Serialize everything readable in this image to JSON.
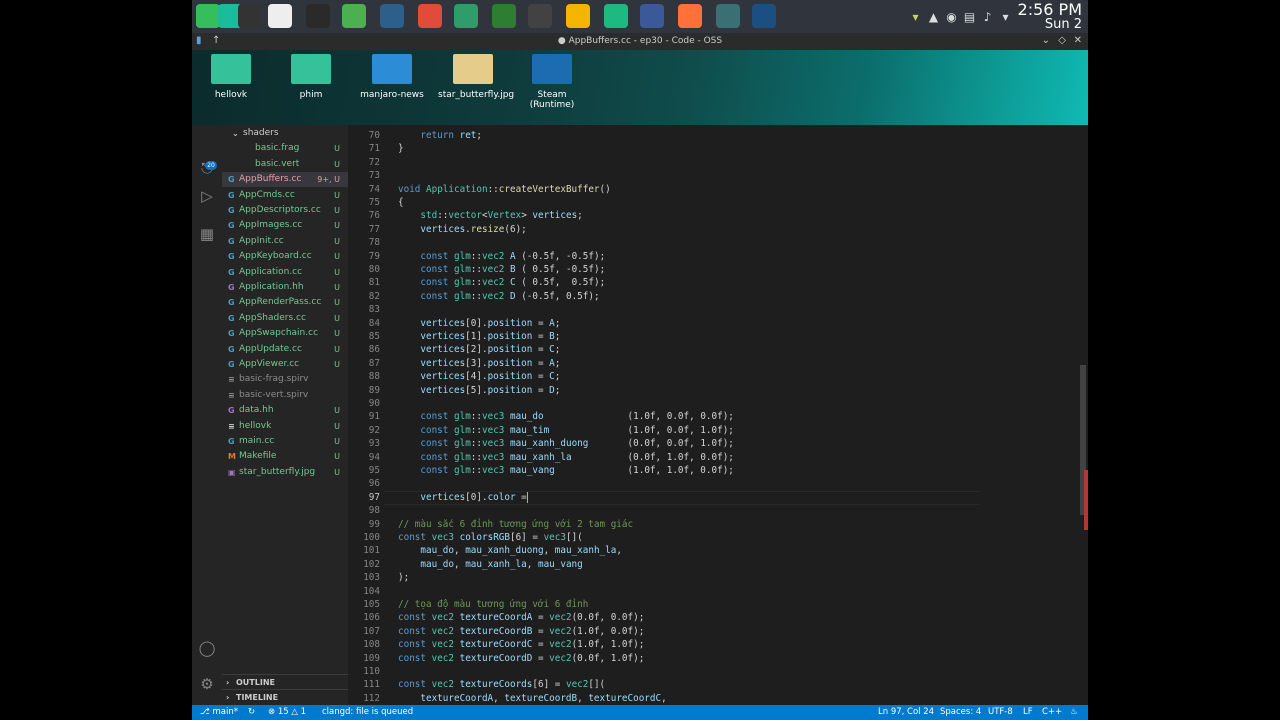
{
  "taskbar": {
    "clock_time": "2:56 PM",
    "clock_date": "Sun 2",
    "app_icons": [
      {
        "name": "manjaro-icon",
        "color": "#35bf5c"
      },
      {
        "name": "show-desktop-icon",
        "color": "#1abc9c"
      },
      {
        "name": "terminal-icon",
        "color": "#333333"
      },
      {
        "name": "settings-grid-icon",
        "color": "#eeeeee"
      },
      {
        "name": "obs-icon",
        "color": "#2a2a2a"
      },
      {
        "name": "files-icon",
        "color": "#4caf50"
      },
      {
        "name": "vscode-icon",
        "color": "#2d5f8b"
      },
      {
        "name": "chrome-icon",
        "color": "#e24a3a"
      },
      {
        "name": "green-app-icon",
        "color": "#2e9d6a"
      },
      {
        "name": "spreadsheet-icon",
        "color": "#2e7d32"
      },
      {
        "name": "terminal-2-icon",
        "color": "#424242"
      },
      {
        "name": "color-app-icon",
        "color": "#f4b400"
      },
      {
        "name": "whatsapp-icon",
        "color": "#1db980"
      },
      {
        "name": "triangle-app-icon",
        "color": "#3b5998"
      },
      {
        "name": "firefox-icon",
        "color": "#ff7139"
      },
      {
        "name": "gear-app-icon",
        "color": "#3a6f73"
      },
      {
        "name": "steam-icon",
        "color": "#1b4f82"
      }
    ]
  },
  "window": {
    "title": "● AppBuffers.cc - ep30 - Code - OSS"
  },
  "desktop": {
    "icons": [
      {
        "label": "hellovk",
        "color": "#35c29a"
      },
      {
        "label": "phim",
        "color": "#35c29a"
      },
      {
        "label": "manjaro-news",
        "color": "#2c8cd6"
      },
      {
        "label": "star_butterfly.jpg",
        "color": "#e6cc8a"
      },
      {
        "label": "Steam (Runtime)",
        "color": "#1b6cb0"
      }
    ]
  },
  "sidebar": {
    "files": [
      {
        "name": "shaders",
        "icon": "⌄",
        "icon_color": "#cccccc",
        "status": "",
        "color": "#cccccc",
        "indent": 10
      },
      {
        "name": "basic.frag",
        "icon": "",
        "icon_color": "#cccccc",
        "status": "U",
        "color": "#73c991",
        "indent": 22
      },
      {
        "name": "basic.vert",
        "icon": "",
        "icon_color": "#cccccc",
        "status": "U",
        "color": "#73c991",
        "indent": 22
      },
      {
        "name": "AppBuffers.cc",
        "icon": "G",
        "icon_color": "#519aba",
        "status": "9+, U",
        "color": "#e2a0a0",
        "indent": 6
      },
      {
        "name": "AppCmds.cc",
        "icon": "G",
        "icon_color": "#519aba",
        "status": "U",
        "color": "#73c991",
        "indent": 6
      },
      {
        "name": "AppDescriptors.cc",
        "icon": "G",
        "icon_color": "#519aba",
        "status": "U",
        "color": "#73c991",
        "indent": 6
      },
      {
        "name": "AppImages.cc",
        "icon": "G",
        "icon_color": "#519aba",
        "status": "U",
        "color": "#73c991",
        "indent": 6
      },
      {
        "name": "AppInit.cc",
        "icon": "G",
        "icon_color": "#519aba",
        "status": "U",
        "color": "#73c991",
        "indent": 6
      },
      {
        "name": "AppKeyboard.cc",
        "icon": "G",
        "icon_color": "#519aba",
        "status": "U",
        "color": "#73c991",
        "indent": 6
      },
      {
        "name": "Application.cc",
        "icon": "G",
        "icon_color": "#519aba",
        "status": "U",
        "color": "#73c991",
        "indent": 6
      },
      {
        "name": "Application.hh",
        "icon": "G",
        "icon_color": "#a074c4",
        "status": "U",
        "color": "#73c991",
        "indent": 6
      },
      {
        "name": "AppRenderPass.cc",
        "icon": "G",
        "icon_color": "#519aba",
        "status": "U",
        "color": "#73c991",
        "indent": 6
      },
      {
        "name": "AppShaders.cc",
        "icon": "G",
        "icon_color": "#519aba",
        "status": "U",
        "color": "#73c991",
        "indent": 6
      },
      {
        "name": "AppSwapchain.cc",
        "icon": "G",
        "icon_color": "#519aba",
        "status": "U",
        "color": "#73c991",
        "indent": 6
      },
      {
        "name": "AppUpdate.cc",
        "icon": "G",
        "icon_color": "#519aba",
        "status": "U",
        "color": "#73c991",
        "indent": 6
      },
      {
        "name": "AppViewer.cc",
        "icon": "G",
        "icon_color": "#519aba",
        "status": "U",
        "color": "#73c991",
        "indent": 6
      },
      {
        "name": "basic-frag.spirv",
        "icon": "≡",
        "icon_color": "#8a8a8a",
        "status": "",
        "color": "#8c8c8c",
        "indent": 6
      },
      {
        "name": "basic-vert.spirv",
        "icon": "≡",
        "icon_color": "#8a8a8a",
        "status": "",
        "color": "#8c8c8c",
        "indent": 6
      },
      {
        "name": "data.hh",
        "icon": "G",
        "icon_color": "#a074c4",
        "status": "U",
        "color": "#73c991",
        "indent": 6
      },
      {
        "name": "hellovk",
        "icon": "≡",
        "icon_color": "#cccccc",
        "status": "U",
        "color": "#73c991",
        "indent": 6
      },
      {
        "name": "main.cc",
        "icon": "G",
        "icon_color": "#519aba",
        "status": "U",
        "color": "#73c991",
        "indent": 6
      },
      {
        "name": "Makefile",
        "icon": "M",
        "icon_color": "#e37933",
        "status": "U",
        "color": "#73c991",
        "indent": 6
      },
      {
        "name": "star_butterfly.jpg",
        "icon": "▣",
        "icon_color": "#a074c4",
        "status": "U",
        "color": "#73c991",
        "indent": 6
      }
    ],
    "outline_label": "OUTLINE",
    "timeline_label": "TIMELINE"
  },
  "editor": {
    "lines": [
      {
        "n": "70",
        "code": "    <span class=\"kw\">return</span> <span class=\"vr\">ret</span>;"
      },
      {
        "n": "71",
        "code": "}"
      },
      {
        "n": "72",
        "code": ""
      },
      {
        "n": "73",
        "code": ""
      },
      {
        "n": "74",
        "code": "<span class=\"kw\">void</span> <span class=\"ty\">Application</span>::<span class=\"fn\">createVertexBuffer</span>()"
      },
      {
        "n": "75",
        "code": "{"
      },
      {
        "n": "76",
        "code": "    <span class=\"ty\">std</span>::<span class=\"ty\">vector</span>&lt;<span class=\"ty\">Vertex</span>&gt; <span class=\"vr\">vertices</span>;"
      },
      {
        "n": "77",
        "code": "    <span class=\"vr\">vertices</span>.<span class=\"fn\">resize</span>(6);"
      },
      {
        "n": "78",
        "code": ""
      },
      {
        "n": "79",
        "code": "    <span class=\"kw\">const</span> <span class=\"ty\">glm</span>::<span class=\"ty\">vec2</span> <span class=\"vr\">A</span> (-0.5f, -0.5f);"
      },
      {
        "n": "80",
        "code": "    <span class=\"kw\">const</span> <span class=\"ty\">glm</span>::<span class=\"ty\">vec2</span> <span class=\"vr\">B</span> ( 0.5f, -0.5f);"
      },
      {
        "n": "81",
        "code": "    <span class=\"kw\">const</span> <span class=\"ty\">glm</span>::<span class=\"ty\">vec2</span> <span class=\"vr\">C</span> ( 0.5f,  0.5f);"
      },
      {
        "n": "82",
        "code": "    <span class=\"kw\">const</span> <span class=\"ty\">glm</span>::<span class=\"ty\">vec2</span> <span class=\"vr\">D</span> (-0.5f, 0.5f);"
      },
      {
        "n": "83",
        "code": ""
      },
      {
        "n": "84",
        "code": "    <span class=\"vr\">vertices</span>[0].<span class=\"vr\">position</span> = <span class=\"vr\">A</span>;"
      },
      {
        "n": "85",
        "code": "    <span class=\"vr\">vertices</span>[1].<span class=\"vr\">position</span> = <span class=\"vr\">B</span>;"
      },
      {
        "n": "86",
        "code": "    <span class=\"vr\">vertices</span>[2].<span class=\"vr\">position</span> = <span class=\"vr\">C</span>;"
      },
      {
        "n": "87",
        "code": "    <span class=\"vr\">vertices</span>[3].<span class=\"vr\">position</span> = <span class=\"vr\">A</span>;"
      },
      {
        "n": "88",
        "code": "    <span class=\"vr\">vertices</span>[4].<span class=\"vr\">position</span> = <span class=\"vr\">C</span>;"
      },
      {
        "n": "89",
        "code": "    <span class=\"vr\">vertices</span>[5].<span class=\"vr\">position</span> = <span class=\"vr\">D</span>;"
      },
      {
        "n": "90",
        "code": ""
      },
      {
        "n": "91",
        "code": "    <span class=\"kw\">const</span> <span class=\"ty\">glm</span>::<span class=\"ty\">vec3</span> <span class=\"vr\">mau_do</span>               (1.0f, 0.0f, 0.0f);"
      },
      {
        "n": "92",
        "code": "    <span class=\"kw\">const</span> <span class=\"ty\">glm</span>::<span class=\"ty\">vec3</span> <span class=\"vr\">mau_tim</span>              (1.0f, 0.0f, 1.0f);"
      },
      {
        "n": "93",
        "code": "    <span class=\"kw\">const</span> <span class=\"ty\">glm</span>::<span class=\"ty\">vec3</span> <span class=\"vr\">mau_xanh_duong</span>       (0.0f, 0.0f, 1.0f);"
      },
      {
        "n": "94",
        "code": "    <span class=\"kw\">const</span> <span class=\"ty\">glm</span>::<span class=\"ty\">vec3</span> <span class=\"vr\">mau_xanh_la</span>          (0.0f, 1.0f, 0.0f);"
      },
      {
        "n": "95",
        "code": "    <span class=\"kw\">const</span> <span class=\"ty\">glm</span>::<span class=\"ty\">vec3</span> <span class=\"vr\">mau_vang</span>             (1.0f, 1.0f, 0.0f);"
      },
      {
        "n": "96",
        "code": ""
      },
      {
        "n": "97",
        "code": "    <span class=\"vr\">vertices</span>[0].<span class=\"vr\">color</span> =<span class=\"caret\"></span>",
        "current": true
      },
      {
        "n": "98",
        "code": ""
      },
      {
        "n": "99",
        "code": "<span class=\"cm\">// màu sắc 6 đỉnh tương ứng với 2 tam giác</span>"
      },
      {
        "n": "100",
        "code": "<span class=\"kw\">const</span> <span class=\"ty\">vec3</span> <span class=\"vr\">colorsRGB</span>[6] = <span class=\"ty\">vec3</span>[]("
      },
      {
        "n": "101",
        "code": "    <span class=\"vr\">mau_do</span>, <span class=\"vr\">mau_xanh_duong</span>, <span class=\"vr\">mau_xanh_la</span>,"
      },
      {
        "n": "102",
        "code": "    <span class=\"vr\">mau_do</span>, <span class=\"vr\">mau_xanh_la</span>, <span class=\"vr\">mau_vang</span>"
      },
      {
        "n": "103",
        "code": ");"
      },
      {
        "n": "104",
        "code": ""
      },
      {
        "n": "105",
        "code": "<span class=\"cm\">// tọa độ màu tương ứng với 6 đỉnh</span>"
      },
      {
        "n": "106",
        "code": "<span class=\"kw\">const</span> <span class=\"ty\">vec2</span> <span class=\"vr\">textureCoordA</span> = <span class=\"ty\">vec2</span>(0.0f, 0.0f);"
      },
      {
        "n": "107",
        "code": "<span class=\"kw\">const</span> <span class=\"ty\">vec2</span> <span class=\"vr\">textureCoordB</span> = <span class=\"ty\">vec2</span>(1.0f, 0.0f);"
      },
      {
        "n": "108",
        "code": "<span class=\"kw\">const</span> <span class=\"ty\">vec2</span> <span class=\"vr\">textureCoordC</span> = <span class=\"ty\">vec2</span>(1.0f, 1.0f);"
      },
      {
        "n": "109",
        "code": "<span class=\"kw\">const</span> <span class=\"ty\">vec2</span> <span class=\"vr\">textureCoordD</span> = <span class=\"ty\">vec2</span>(0.0f, 1.0f);"
      },
      {
        "n": "110",
        "code": ""
      },
      {
        "n": "111",
        "code": "<span class=\"kw\">const</span> <span class=\"ty\">vec2</span> <span class=\"vr\">textureCoords</span>[6] = <span class=\"ty\">vec2</span>[]("
      },
      {
        "n": "112",
        "code": "    <span class=\"vr\">textureCoordA</span>, <span class=\"vr\">textureCoordB</span>, <span class=\"vr\">textureCoordC</span>,"
      }
    ]
  },
  "statusbar": {
    "branch": "main*",
    "problems_errors": "15",
    "problems_warnings": "1",
    "clangd": "clangd: file is queued",
    "cursor": "Ln 97, Col 24",
    "spaces": "Spaces: 4",
    "encoding": "UTF-8",
    "eol": "LF",
    "language": "C++"
  }
}
